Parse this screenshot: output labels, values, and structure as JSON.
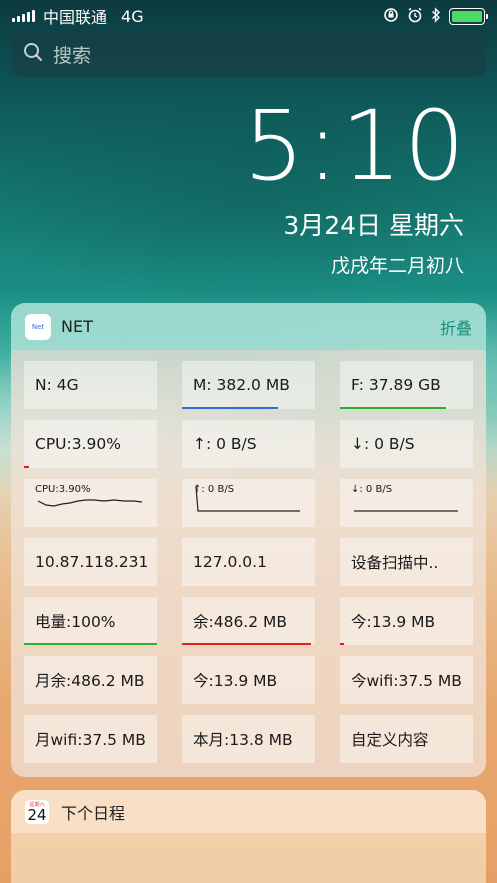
{
  "status_bar": {
    "carrier": "中国联通",
    "network": "4G",
    "icons": [
      "orientation-lock-icon",
      "alarm-icon",
      "bluetooth-icon",
      "battery-icon"
    ],
    "battery_color": "#4cd964"
  },
  "search": {
    "placeholder": "搜索"
  },
  "lockscreen": {
    "time": "5:10",
    "date": "3月24日 星期六",
    "lunar": "戊戌年二月初八"
  },
  "net_widget": {
    "app_icon_text": "Net",
    "title": "NET",
    "collapse_label": "折叠",
    "cells": [
      {
        "text": "N: 4G"
      },
      {
        "text": "M: 382.0 MB",
        "bar_color": "#2f6fd6",
        "bar_fraction": 0.72
      },
      {
        "text": "F: 37.89 GB",
        "bar_color": "#2bb02b",
        "bar_fraction": 0.8
      },
      {
        "text": "CPU:3.90%",
        "bar_color": "#e02020",
        "bar_fraction": 0.04
      },
      {
        "text": "↑: 0 B/S"
      },
      {
        "text": "↓: 0 B/S"
      },
      {
        "text": "CPU:3.90%"
      },
      {
        "text": "↑: 0 B/S"
      },
      {
        "text": "↓: 0 B/S"
      },
      {
        "text": "10.87.118.231"
      },
      {
        "text": "127.0.0.1"
      },
      {
        "text": "设备扫描中.."
      },
      {
        "text": "电量:100%",
        "bar_color": "#2bb02b",
        "bar_fraction": 1.0
      },
      {
        "text": "余:486.2 MB",
        "bar_color": "#e02020",
        "bar_fraction": 0.97
      },
      {
        "text": "今:13.9 MB",
        "bar_color": "#e02020",
        "bar_fraction": 0.03
      },
      {
        "text": "月余:486.2 MB"
      },
      {
        "text": "今:13.9 MB"
      },
      {
        "text": "今wifi:37.5 MB"
      },
      {
        "text": "月wifi:37.5 MB"
      },
      {
        "text": "本月:13.8 MB"
      },
      {
        "text": "自定义内容"
      }
    ]
  },
  "calendar_widget": {
    "icon_weekday": "星期六",
    "icon_day": "24",
    "title": "下个日程"
  }
}
